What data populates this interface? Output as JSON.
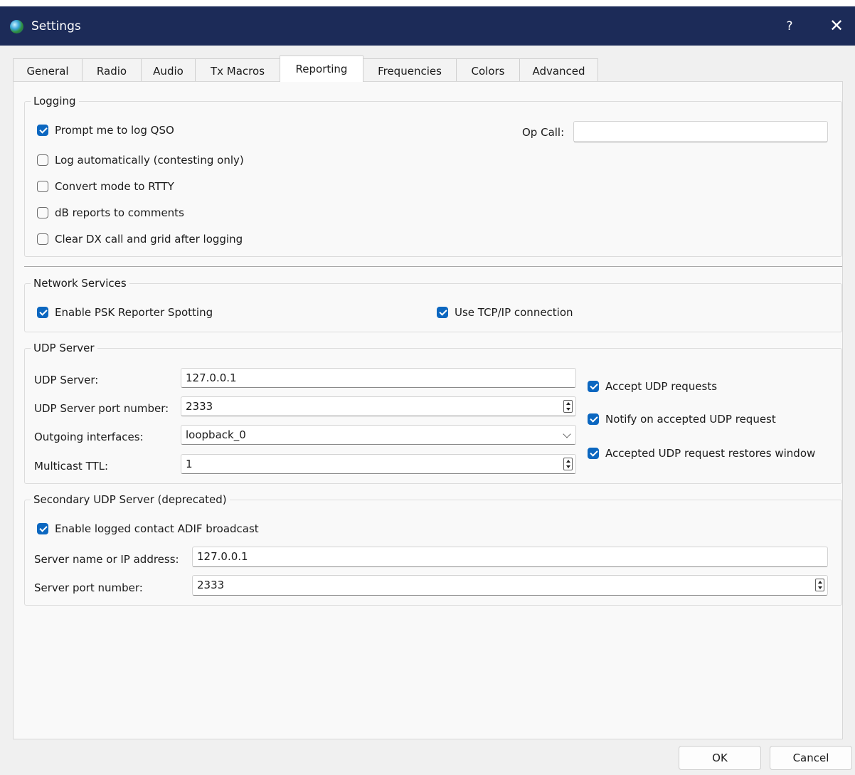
{
  "window": {
    "title": "Settings",
    "help_label": "?",
    "close_label": "✕",
    "app_icon": "globe-icon"
  },
  "tabs": [
    {
      "label": "General",
      "active": false
    },
    {
      "label": "Radio",
      "active": false
    },
    {
      "label": "Audio",
      "active": false
    },
    {
      "label": "Tx Macros",
      "active": false
    },
    {
      "label": "Reporting",
      "active": true
    },
    {
      "label": "Frequencies",
      "active": false
    },
    {
      "label": "Colors",
      "active": false
    },
    {
      "label": "Advanced",
      "active": false
    }
  ],
  "logging": {
    "legend": "Logging",
    "checkboxes": [
      {
        "label": "Prompt me to log QSO",
        "checked": true
      },
      {
        "label": "Log automatically (contesting only)",
        "checked": false
      },
      {
        "label": "Convert mode to RTTY",
        "checked": false
      },
      {
        "label": "dB reports to comments",
        "checked": false
      },
      {
        "label": "Clear DX call and grid after logging",
        "checked": false
      }
    ],
    "op_call_label": "Op Call:",
    "op_call_value": ""
  },
  "network": {
    "legend": "Network Services",
    "psk_label": "Enable PSK Reporter Spotting",
    "psk_checked": true,
    "tcp_label": "Use TCP/IP connection",
    "tcp_checked": true
  },
  "udp": {
    "legend": "UDP Server",
    "server_label": "UDP Server:",
    "server_value": "127.0.0.1",
    "port_label": "UDP Server port number:",
    "port_value": "2333",
    "iface_label": "Outgoing interfaces:",
    "iface_value": "loopback_0",
    "ttl_label": "Multicast TTL:",
    "ttl_value": "1",
    "accept_label": "Accept UDP requests",
    "accept_checked": true,
    "notify_label": "Notify on accepted UDP request",
    "notify_checked": true,
    "restore_label": "Accepted UDP request restores window",
    "restore_checked": true
  },
  "secondary": {
    "legend": "Secondary UDP Server (deprecated)",
    "adif_label": "Enable logged contact ADIF broadcast",
    "adif_checked": true,
    "name_label": "Server name or IP address:",
    "name_value": "127.0.0.1",
    "port_label": "Server port number:",
    "port_value": "2333"
  },
  "buttons": {
    "ok": "OK",
    "cancel": "Cancel"
  }
}
